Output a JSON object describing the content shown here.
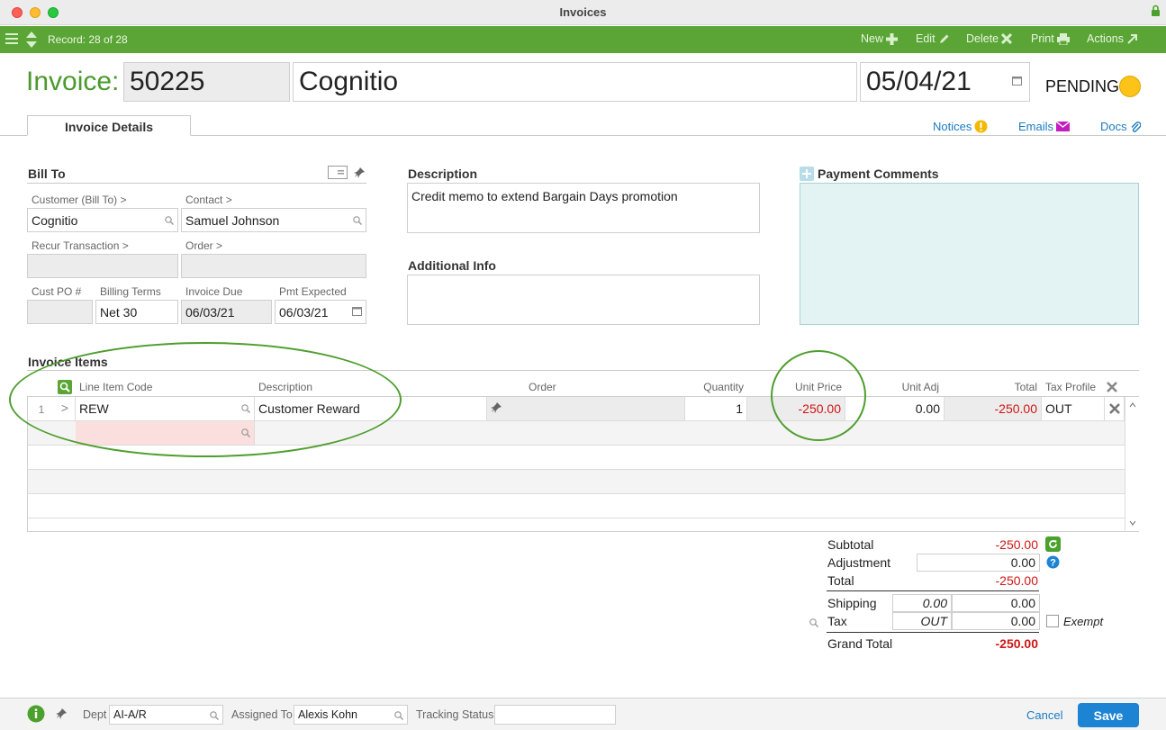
{
  "window": {
    "title": "Invoices"
  },
  "toolbar": {
    "record": "Record: 28 of 28",
    "new": "New",
    "edit": "Edit",
    "delete": "Delete",
    "print": "Print",
    "actions": "Actions"
  },
  "header": {
    "invoice_label": "Invoice:",
    "invoice_number": "50225",
    "customer": "Cognitio",
    "date": "05/04/21",
    "status": "PENDING",
    "status_color": "#fcc419"
  },
  "tabs": {
    "details": "Invoice Details",
    "notices": "Notices",
    "emails": "Emails",
    "docs": "Docs"
  },
  "bill_to": {
    "title": "Bill To",
    "customer_label": "Customer (Bill To) >",
    "customer_value": "Cognitio",
    "contact_label": "Contact >",
    "contact_value": "Samuel Johnson",
    "recur_label": "Recur Transaction >",
    "order_label": "Order >",
    "cust_po_label": "Cust PO #",
    "billing_terms_label": "Billing Terms",
    "billing_terms_value": "Net 30",
    "invoice_due_label": "Invoice Due",
    "invoice_due_value": "06/03/21",
    "pmt_expected_label": "Pmt Expected",
    "pmt_expected_value": "06/03/21"
  },
  "description": {
    "title": "Description",
    "value": "Credit memo to extend Bargain Days promotion"
  },
  "additional_info": {
    "title": "Additional Info",
    "value": ""
  },
  "payment_comments": {
    "title": "Payment Comments"
  },
  "items": {
    "title": "Invoice Items",
    "columns": {
      "line_item_code": "Line Item Code",
      "description": "Description",
      "order": "Order",
      "quantity": "Quantity",
      "unit_price": "Unit Price",
      "unit_adj": "Unit Adj",
      "total": "Total",
      "tax_profile": "Tax Profile"
    },
    "rows": [
      {
        "num": "1",
        "expand": ">",
        "code": "REW",
        "description": "Customer Reward",
        "order": "",
        "quantity": "1",
        "unit_price": "-250.00",
        "unit_adj": "0.00",
        "total": "-250.00",
        "tax_profile": "OUT"
      }
    ]
  },
  "totals": {
    "subtotal_label": "Subtotal",
    "subtotal": "-250.00",
    "adjustment_label": "Adjustment",
    "adjustment": "0.00",
    "total_label": "Total",
    "total": "-250.00",
    "shipping_label": "Shipping",
    "shipping_rate": "0.00",
    "shipping": "0.00",
    "tax_label": "Tax",
    "tax_code": "OUT",
    "tax": "0.00",
    "exempt_label": "Exempt",
    "grand_total_label": "Grand Total",
    "grand_total": "-250.00"
  },
  "footer": {
    "dept_label": "Dept",
    "dept_value": "AI-A/R",
    "assigned_label": "Assigned To",
    "assigned_value": "Alexis Kohn",
    "tracking_label": "Tracking Status",
    "tracking_value": "",
    "cancel": "Cancel",
    "save": "Save"
  },
  "colors": {
    "accent_green": "#5aa536",
    "negative_red": "#d01515",
    "link_blue": "#1c7bc0",
    "comments_bg": "#e3f3f3"
  }
}
